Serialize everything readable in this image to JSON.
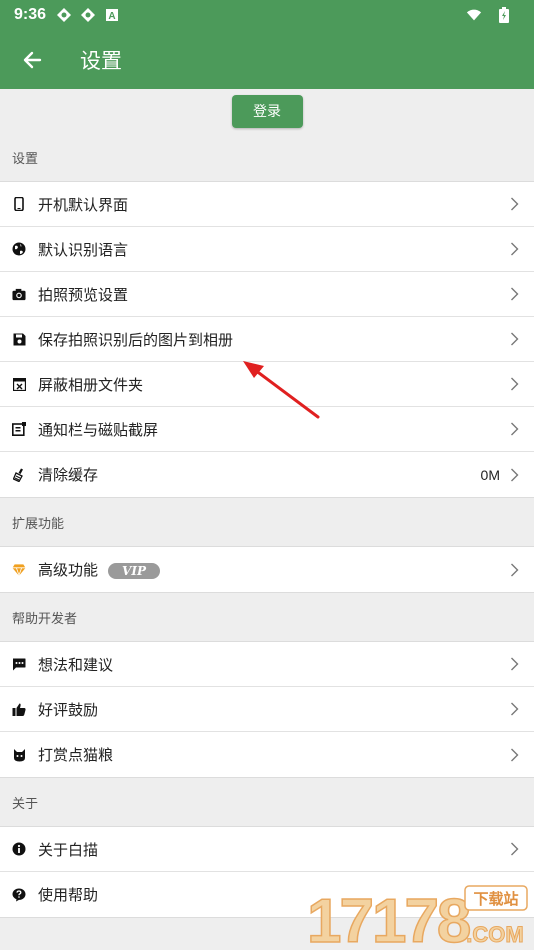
{
  "status_bar": {
    "time": "9:36"
  },
  "app_bar": {
    "title": "设置"
  },
  "login_label": "登录",
  "sections": [
    {
      "header": "设置",
      "items": [
        {
          "label": "开机默认界面",
          "icon": "phone-icon"
        },
        {
          "label": "默认识别语言",
          "icon": "globe-icon"
        },
        {
          "label": "拍照预览设置",
          "icon": "camera-icon"
        },
        {
          "label": "保存拍照识别后的图片到相册",
          "icon": "save-icon"
        },
        {
          "label": "屏蔽相册文件夹",
          "icon": "folder-block-icon"
        },
        {
          "label": "通知栏与磁贴截屏",
          "icon": "screenshot-icon"
        },
        {
          "label": "清除缓存",
          "icon": "broom-icon",
          "value": "0M"
        }
      ]
    },
    {
      "header": "扩展功能",
      "items": [
        {
          "label": "高级功能",
          "icon": "diamond-icon",
          "badge": "VIP"
        }
      ]
    },
    {
      "header": "帮助开发者",
      "items": [
        {
          "label": "想法和建议",
          "icon": "chat-icon"
        },
        {
          "label": "好评鼓励",
          "icon": "thumbs-up-icon"
        },
        {
          "label": "打赏点猫粮",
          "icon": "cat-icon"
        }
      ]
    },
    {
      "header": "关于",
      "items": [
        {
          "label": "关于白描",
          "icon": "info-icon"
        },
        {
          "label": "使用帮助",
          "icon": "help-icon"
        }
      ]
    }
  ],
  "watermark": {
    "text": "17178",
    "badge": "下载站",
    "suffix": ".COM"
  },
  "colors": {
    "primary": "#4c9a5a",
    "arrow": "#e02020",
    "vip_badge": "#9a9a9a",
    "diamond": "#f0a020"
  }
}
